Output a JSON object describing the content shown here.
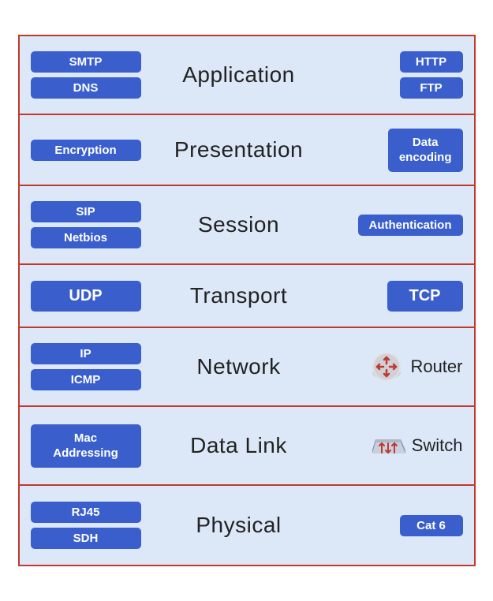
{
  "layers": [
    {
      "id": "application",
      "name": "Application",
      "left_badges": [
        "SMTP",
        "DNS"
      ],
      "right_badges": [
        "HTTP",
        "FTP"
      ],
      "has_device": false
    },
    {
      "id": "presentation",
      "name": "Presentation",
      "left_badges": [
        "Encryption"
      ],
      "right_badges_multiline": [
        {
          "line1": "Data",
          "line2": "encoding"
        }
      ],
      "has_device": false
    },
    {
      "id": "session",
      "name": "Session",
      "left_badges": [
        "SIP",
        "Netbios"
      ],
      "right_badges": [
        "Authentication"
      ],
      "has_device": false
    },
    {
      "id": "transport",
      "name": "Transport",
      "left_badges": [
        "UDP"
      ],
      "right_badges": [
        "TCP"
      ],
      "has_device": false
    },
    {
      "id": "network",
      "name": "Network",
      "left_badges": [
        "IP",
        "ICMP"
      ],
      "device": "Router",
      "has_device": true
    },
    {
      "id": "datalink",
      "name": "Data Link",
      "left_badges_multiline": [
        {
          "line1": "Mac",
          "line2": "Addressing"
        }
      ],
      "device": "Switch",
      "has_device": true
    },
    {
      "id": "physical",
      "name": "Physical",
      "left_badges": [
        "RJ45",
        "SDH"
      ],
      "right_badges": [
        "Cat 6"
      ],
      "has_device": false
    }
  ]
}
